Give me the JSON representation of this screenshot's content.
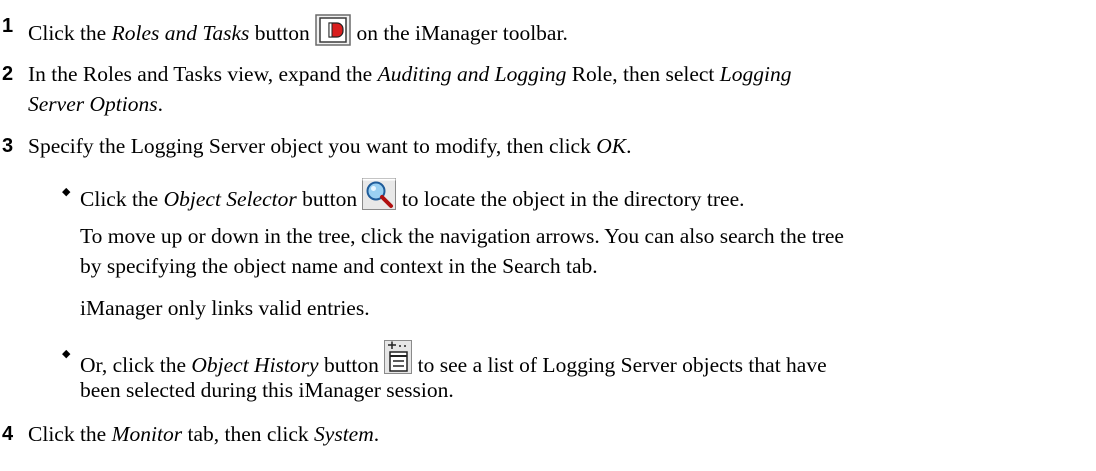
{
  "steps": [
    {
      "number": "1",
      "pre": "Click the ",
      "em": "Roles and Tasks",
      "mid": " button ",
      "post": " on the iManager toolbar."
    },
    {
      "number": "2",
      "line1_pre": "In the Roles and Tasks view, expand the ",
      "line1_em": "Auditing and Logging",
      "line1_mid": " Role, then select ",
      "line1_em2": "Logging",
      "line2_em": "Server Options",
      "line2_post": "."
    },
    {
      "number": "3",
      "pre": "Specify the Logging Server object you want to modify, then click ",
      "em": "OK",
      "post": ".",
      "bullets": [
        {
          "pre": "Click the ",
          "em": "Object Selector",
          "mid": " button ",
          "post": " to locate the object in the directory tree.",
          "para1_line1": "To move up or down in the tree, click the navigation arrows. You can also search the tree",
          "para1_line2": "by specifying the object name and context in the Search tab.",
          "para2": "iManager only links valid entries."
        },
        {
          "pre": "Or, click the ",
          "em": "Object History",
          "mid": " button ",
          "post": " to see a list of Logging Server objects that have",
          "line2": "been selected during this iManager session."
        }
      ]
    },
    {
      "number": "4",
      "pre": "Click the ",
      "em": "Monitor",
      "mid": " tab, then click ",
      "em2": "System",
      "post": "."
    }
  ],
  "icons": {
    "roles_tasks": "roles-and-tasks-icon",
    "object_selector": "magnifier-icon",
    "object_history": "object-history-icon"
  }
}
